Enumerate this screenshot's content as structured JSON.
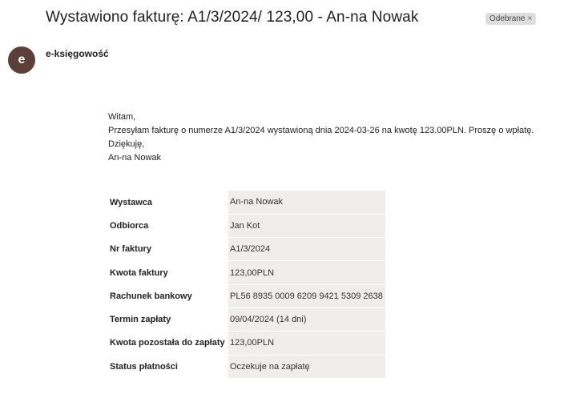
{
  "email": {
    "subject": "Wystawiono fakturę: A1/3/2024/ 123,00 - An-na Nowak",
    "label": "Odebrane",
    "label_close": "×",
    "sender_initial": "e",
    "sender_name": "e-księgowość"
  },
  "message": {
    "greeting": "Witam,",
    "line1": "Przesyłam fakturę o numerze A1/3/2024 wystawioną dnia 2024-03-26 na kwotę 123.00PLN. Proszę o wpłatę.",
    "thanks": "Dziękuję,",
    "signature": "An-na Nowak"
  },
  "invoice": {
    "rows": [
      {
        "label": "Wystawca",
        "value": "An-na Nowak"
      },
      {
        "label": "Odbiorca",
        "value": "Jan Kot"
      },
      {
        "label": "Nr faktury",
        "value": "A1/3/2024"
      },
      {
        "label": "Kwota faktury",
        "value": "123,00PLN"
      },
      {
        "label": "Rachunek bankowy",
        "value": "PL56 8935 0009 6209 9421 5309 2638"
      },
      {
        "label": "Termin zapłaty",
        "value": "09/04/2024 (14 dni)"
      },
      {
        "label": "Kwota pozostała do zapłaty",
        "value": "123,00PLN"
      },
      {
        "label": "Status płatności",
        "value": "Oczekuje na zapłatę"
      }
    ]
  },
  "colors": {
    "avatar": "#5d3f3a",
    "table_value_bg": "#efeeec",
    "chip_bg": "#dddddd"
  }
}
